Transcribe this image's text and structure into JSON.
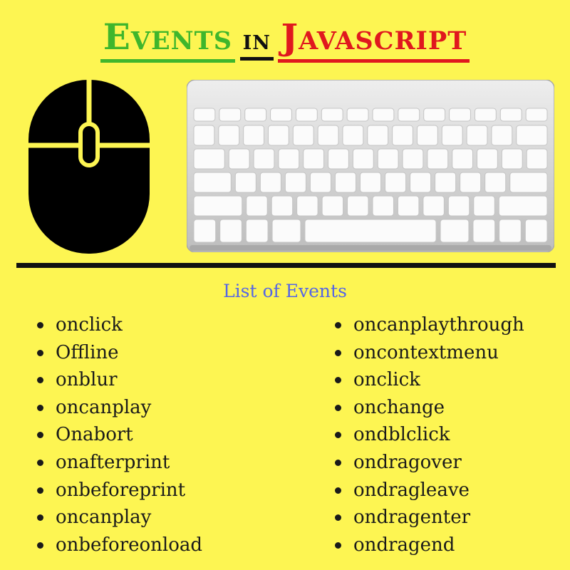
{
  "title": {
    "word1": "Events",
    "word2": "in",
    "word3": "Javascript"
  },
  "icons": {
    "mouse": "computer-mouse-icon",
    "keyboard": "keyboard-icon"
  },
  "colors": {
    "background": "#fdf552",
    "title_events": "#3fb62c",
    "title_in": "#111111",
    "title_javascript": "#e0181e",
    "subtitle": "#5566e6",
    "text": "#1a1a1a"
  },
  "subtitle": "List of Events",
  "events_left": [
    "onclick",
    "Offline",
    "onblur",
    "oncanplay",
    "Onabort",
    "onafterprint",
    "onbeforeprint",
    "oncanplay",
    "onbeforeonload"
  ],
  "events_right": [
    "oncanplaythrough",
    "oncontextmenu",
    "onclick",
    "onchange",
    "ondblclick",
    "ondragover",
    "ondragleave",
    "ondragenter",
    "ondragend"
  ]
}
